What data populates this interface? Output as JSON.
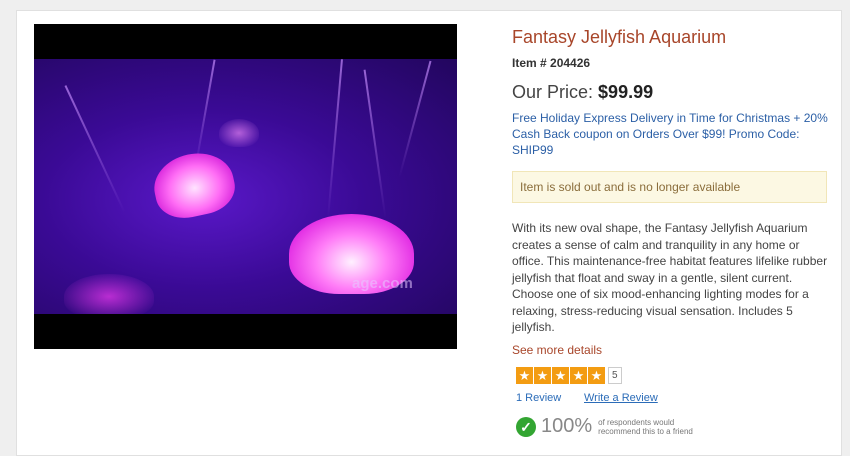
{
  "product": {
    "title": "Fantasy Jellyfish Aquarium",
    "item_number": "Item # 204426",
    "price_label": "Our Price:",
    "price_value": "$99.99",
    "promo": "Free Holiday Express Delivery in Time for Christmas + 20% Cash Back coupon on Orders Over $99! Promo Code: SHIP99",
    "sold_out_notice": "Item is sold out and is no longer available",
    "description": "With its new oval shape, the Fantasy Jellyfish Aquarium creates a sense of calm and tranquility in any home or office. This maintenance-free habitat features lifelike rubber jellyfish that float and sway in a gentle, silent current. Choose one of six mood-enhancing lighting modes for a relaxing, stress-reducing visual sensation. Includes 5 jellyfish.",
    "see_more": "See more details"
  },
  "video": {
    "watermark": "age.com"
  },
  "rating": {
    "stars": 5,
    "score": "5",
    "reviews_link": "1 Review",
    "write_review": "Write a Review",
    "recommend_percent": "100%",
    "recommend_text": "of respondents would recommend this to a friend"
  },
  "colors": {
    "title": "#a8462a",
    "link": "#2b5fa6",
    "star": "#f39c12",
    "check": "#33a532",
    "notice_bg": "#fcf8e3"
  }
}
